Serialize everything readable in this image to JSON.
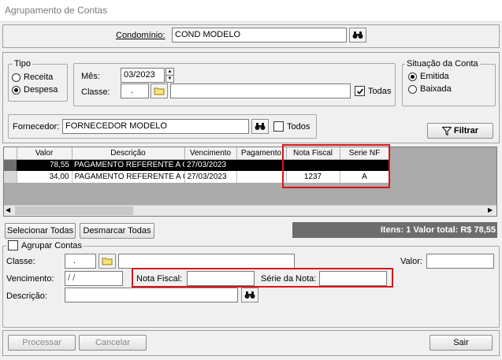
{
  "window": {
    "title": "Agrupamento de Contas"
  },
  "condominio": {
    "label": "Condomínio:",
    "value": "COND MODELO"
  },
  "tipo": {
    "legend": "Tipo",
    "options": [
      {
        "label": "Receita",
        "selected": false
      },
      {
        "label": "Despesa",
        "selected": true
      }
    ]
  },
  "filters": {
    "mes_label": "Mês:",
    "mes_value": "03/2023",
    "classe_label": "Classe:",
    "classe_value": ".",
    "classe_desc": "",
    "todas_label": "Todas",
    "todas_checked": true
  },
  "situacao": {
    "legend": "Situação da Conta",
    "options": [
      {
        "label": "Emitida",
        "selected": true
      },
      {
        "label": "Baixada",
        "selected": false
      }
    ]
  },
  "fornecedor": {
    "label": "Fornecedor:",
    "value": "FORNECEDOR MODELO",
    "todos_label": "Todos",
    "todos_checked": false
  },
  "filtrar_label": "Filtrar",
  "grid": {
    "columns": [
      "Valor",
      "Descrição",
      "Vencimento",
      "Pagamento",
      "Nota Fiscal",
      "Serie NF"
    ],
    "rows": [
      {
        "valor": "78,55",
        "descricao": "PAGAMENTO REFERENTE A C(",
        "vencimento": "27/03/2023",
        "pagamento": "",
        "nota_fiscal": "",
        "serie_nf": ""
      },
      {
        "valor": "34,00",
        "descricao": "PAGAMENTO REFERENTE A C(",
        "vencimento": "27/03/2023",
        "pagamento": "",
        "nota_fiscal": "1237",
        "serie_nf": "A"
      }
    ]
  },
  "actions": {
    "selecionar_todas": "Selecionar Todas",
    "desmarcar_todas": "Desmarcar Todas"
  },
  "summary": "Itens: 1  Valor total: R$ 78,55",
  "agrupar": {
    "legend": "Agrupar Contas",
    "checked": false,
    "classe_label": "Classe:",
    "classe_value": ".",
    "classe_desc": "",
    "valor_label": "Valor:",
    "valor_value": "",
    "vencimento_label": "Vencimento:",
    "vencimento_value": " / /",
    "nota_fiscal_label": "Nota Fiscal:",
    "nota_fiscal_value": "",
    "serie_label": "Série da Nota:",
    "serie_value": "",
    "descricao_label": "Descrição:",
    "descricao_value": ""
  },
  "footer": {
    "processar": "Processar",
    "cancelar": "Cancelar",
    "sair": "Sair"
  },
  "colors": {
    "highlight_red": "#d9141b",
    "summary_bg": "#6d6d6d",
    "selected_row": "#000000"
  }
}
